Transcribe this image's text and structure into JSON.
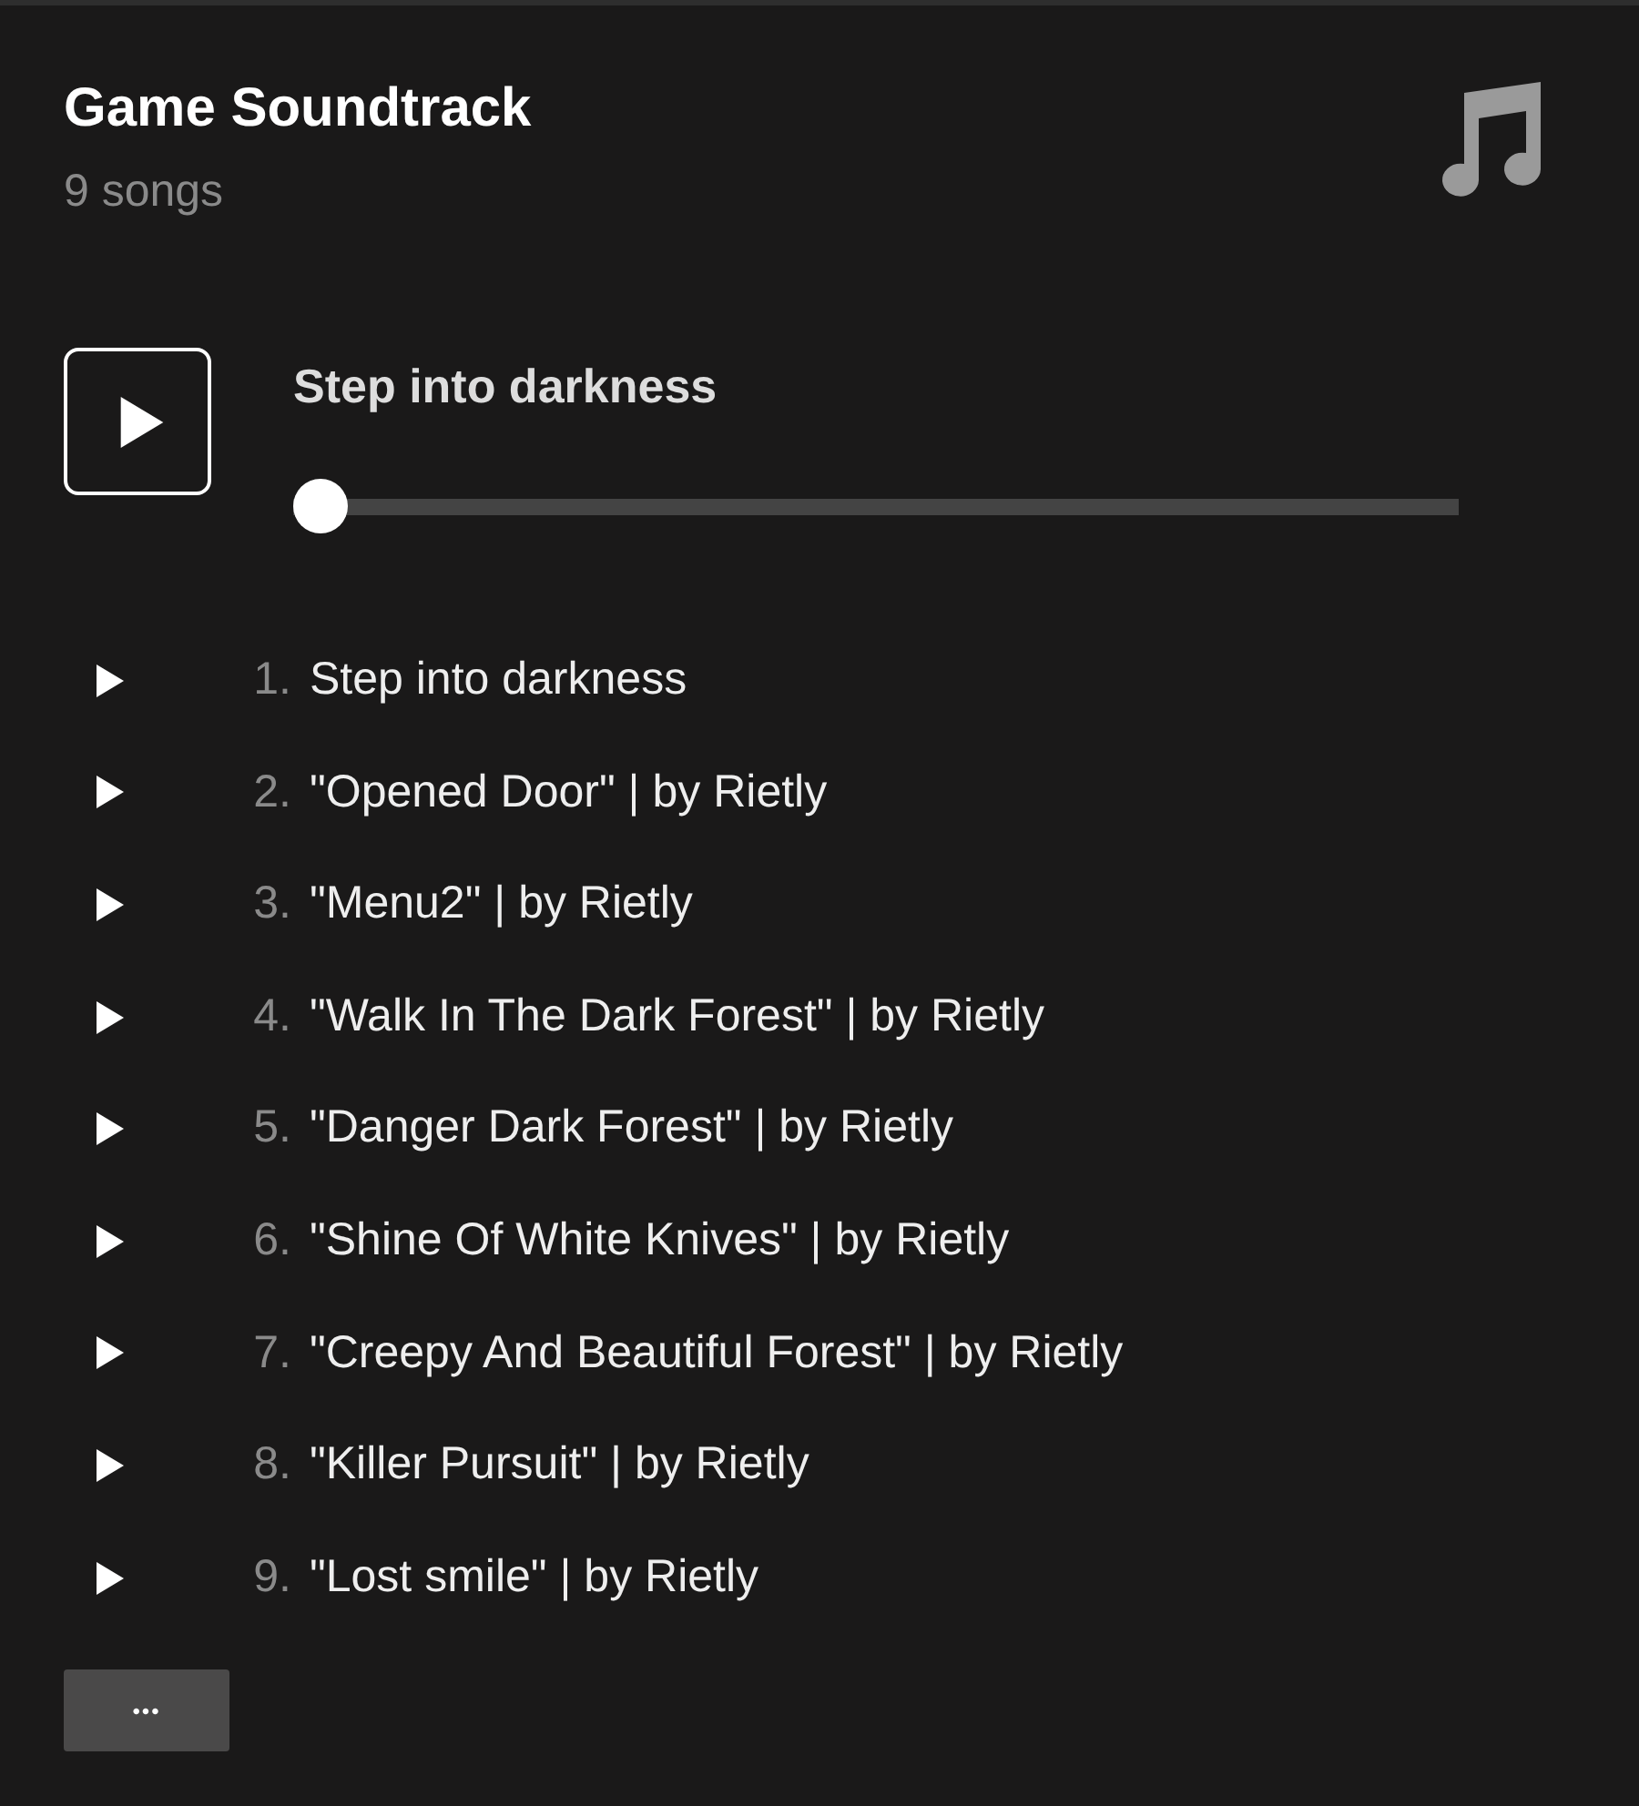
{
  "playlist": {
    "title": "Game Soundtrack",
    "count": "9 songs"
  },
  "player": {
    "track_title": "Step into darkness",
    "level": 0
  },
  "tracks": [
    {
      "number": "1.",
      "title": "Step into darkness"
    },
    {
      "number": "2.",
      "title": "\"Opened Door\" | by Rietly"
    },
    {
      "number": "3.",
      "title": "\"Menu2\" | by Rietly"
    },
    {
      "number": "4.",
      "title": "\"Walk In The Dark Forest\" | by Rietly"
    },
    {
      "number": "5.",
      "title": "\"Danger Dark Forest\" | by Rietly"
    },
    {
      "number": "6.",
      "title": "\"Shine Of White Knives\" | by Rietly"
    },
    {
      "number": "7.",
      "title": "\"Creepy And Beautiful Forest\" | by Rietly"
    },
    {
      "number": "8.",
      "title": "\"Killer Pursuit\" | by Rietly"
    },
    {
      "number": "9.",
      "title": "\"Lost smile\" | by Rietly"
    }
  ],
  "more_button": "•••"
}
